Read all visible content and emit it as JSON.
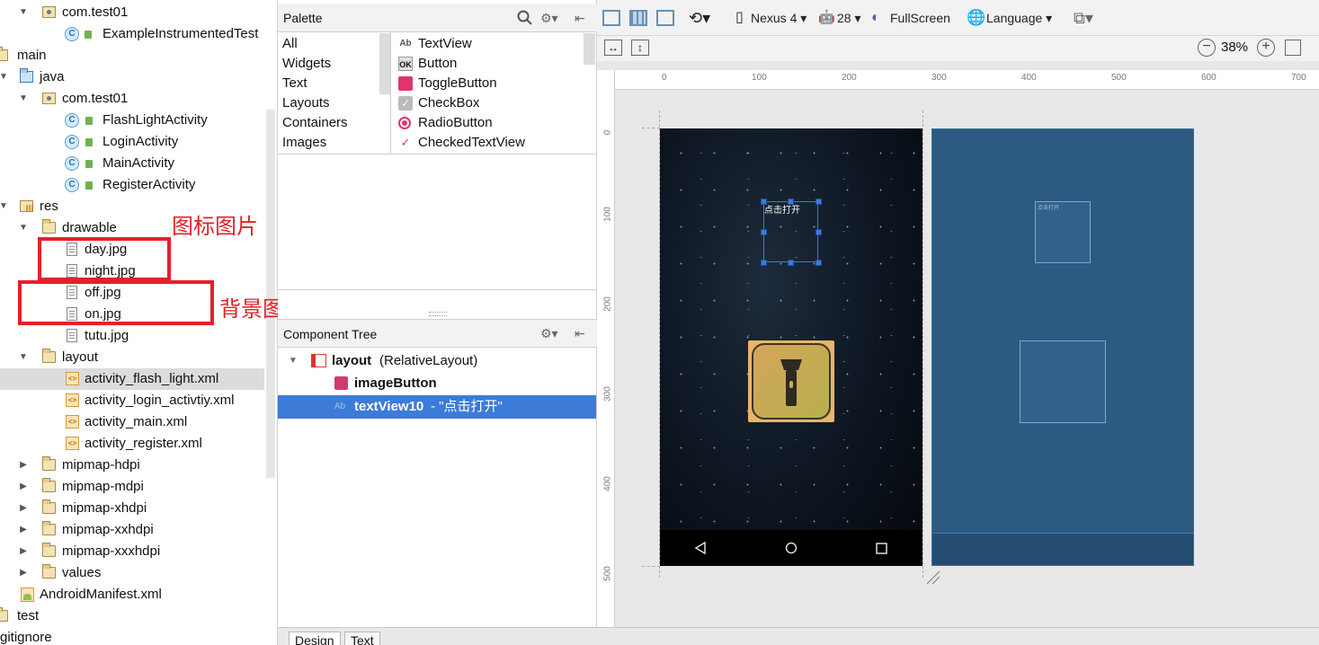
{
  "project_tree": {
    "items": [
      {
        "label": "com.test01",
        "type": "pkg",
        "expanded": true
      },
      {
        "label": "ExampleInstrumentedTest",
        "type": "test-class"
      },
      {
        "label": "main",
        "type": "folder"
      },
      {
        "label": "java",
        "type": "java-folder",
        "expanded": true
      },
      {
        "label": "com.test01",
        "type": "pkg",
        "expanded": true
      },
      {
        "label": "FlashLightActivity",
        "type": "class"
      },
      {
        "label": "LoginActivity",
        "type": "class"
      },
      {
        "label": "MainActivity",
        "type": "class"
      },
      {
        "label": "RegisterActivity",
        "type": "class"
      },
      {
        "label": "res",
        "type": "res-folder",
        "expanded": true
      },
      {
        "label": "drawable",
        "type": "folder",
        "expanded": true
      },
      {
        "label": "day.jpg",
        "type": "file"
      },
      {
        "label": "night.jpg",
        "type": "file"
      },
      {
        "label": "off.jpg",
        "type": "file"
      },
      {
        "label": "on.jpg",
        "type": "file"
      },
      {
        "label": "tutu.jpg",
        "type": "file"
      },
      {
        "label": "layout",
        "type": "folder",
        "expanded": true
      },
      {
        "label": "activity_flash_light.xml",
        "type": "xml",
        "selected": true
      },
      {
        "label": "activity_login_activtiy.xml",
        "type": "xml"
      },
      {
        "label": "activity_main.xml",
        "type": "xml"
      },
      {
        "label": "activity_register.xml",
        "type": "xml"
      },
      {
        "label": "mipmap-hdpi",
        "type": "folder"
      },
      {
        "label": "mipmap-mdpi",
        "type": "folder"
      },
      {
        "label": "mipmap-xhdpi",
        "type": "folder"
      },
      {
        "label": "mipmap-xxhdpi",
        "type": "folder"
      },
      {
        "label": "mipmap-xxxhdpi",
        "type": "folder"
      },
      {
        "label": "values",
        "type": "folder"
      },
      {
        "label": "AndroidManifest.xml",
        "type": "manifest"
      },
      {
        "label": "test",
        "type": "folder"
      },
      {
        "label": "gitignore",
        "type": "file"
      }
    ]
  },
  "annotations": {
    "icon_images": "图标图片",
    "background_images": "背景图片",
    "color": "#e5202a"
  },
  "palette": {
    "title": "Palette",
    "categories": [
      "All",
      "Widgets",
      "Text",
      "Layouts",
      "Containers",
      "Images"
    ],
    "widgets": [
      {
        "label": "TextView",
        "icon": "Ab"
      },
      {
        "label": "Button",
        "icon": "OK"
      },
      {
        "label": "ToggleButton",
        "icon": "toggle-icon"
      },
      {
        "label": "CheckBox",
        "icon": "checkbox-icon"
      },
      {
        "label": "RadioButton",
        "icon": "radio-icon"
      },
      {
        "label": "CheckedTextView",
        "icon": "checked-text-icon"
      }
    ]
  },
  "component_tree": {
    "title": "Component Tree",
    "root_name": "layout",
    "root_type": " (RelativeLayout)",
    "child1": "imageButton",
    "child2_name": "textView10",
    "child2_text": " - \"点击打开\""
  },
  "toolbar": {
    "device": "Nexus 4",
    "api": "28",
    "theme": "FullScreen",
    "language": "Language",
    "zoom": "38%"
  },
  "rulers": {
    "top": [
      "0",
      "100",
      "200",
      "300",
      "400",
      "500",
      "600",
      "700"
    ],
    "left": [
      "0",
      "100",
      "200",
      "300",
      "400",
      "500"
    ]
  },
  "preview": {
    "textview_text": "点击打开",
    "blueprint_text": "点击打开"
  },
  "bottom_tabs": {
    "design": "Design",
    "text": "Text"
  },
  "colors": {
    "selection": "#3d7bd8",
    "blueprint": "#2c5a83"
  }
}
